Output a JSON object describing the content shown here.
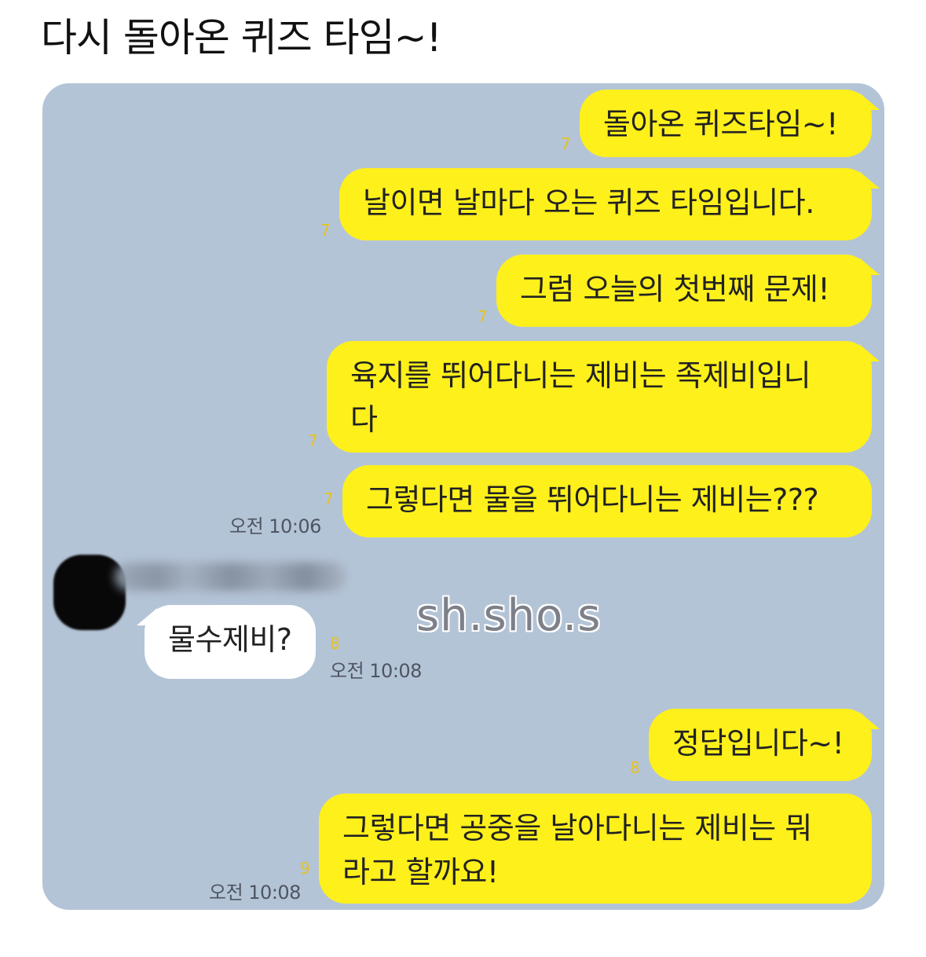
{
  "post": {
    "title": "다시 돌아온 퀴즈 타임~!"
  },
  "watermark": "sh.sho.s",
  "chat": {
    "messages": [
      {
        "sender": "me",
        "lines": [
          "돌아온 퀴즈타임~!"
        ],
        "read_count": "7"
      },
      {
        "sender": "me",
        "lines": [
          "날이면 날마다 오는 퀴즈 타임입니다."
        ],
        "read_count": "7"
      },
      {
        "sender": "me",
        "lines": [
          "그럼 오늘의 첫번째 문제!"
        ],
        "read_count": "7"
      },
      {
        "sender": "me",
        "lines": [
          "육지를 뛰어다니는 제비는 족제비입니",
          "다"
        ],
        "read_count": "7"
      },
      {
        "sender": "me",
        "lines": [
          "그렇다면 물을 뛰어다니는 제비는???"
        ],
        "read_count": "7",
        "time": "오전 10:06"
      },
      {
        "sender": "other",
        "lines": [
          "물수제비?"
        ],
        "read_count": "8",
        "time": "오전 10:08"
      },
      {
        "sender": "me",
        "lines": [
          "정답입니다~!"
        ],
        "read_count": "8"
      },
      {
        "sender": "me",
        "lines": [
          "그렇다면 공중을 날아다니는 제비는 뭐",
          "라고 할까요!"
        ],
        "read_count": "9",
        "time": "오전 10:08"
      }
    ]
  },
  "colors": {
    "chat_background": "#b4c4d7",
    "my_bubble": "#fef01b",
    "other_bubble": "#ffffff",
    "read_count": "#e6c31c"
  }
}
